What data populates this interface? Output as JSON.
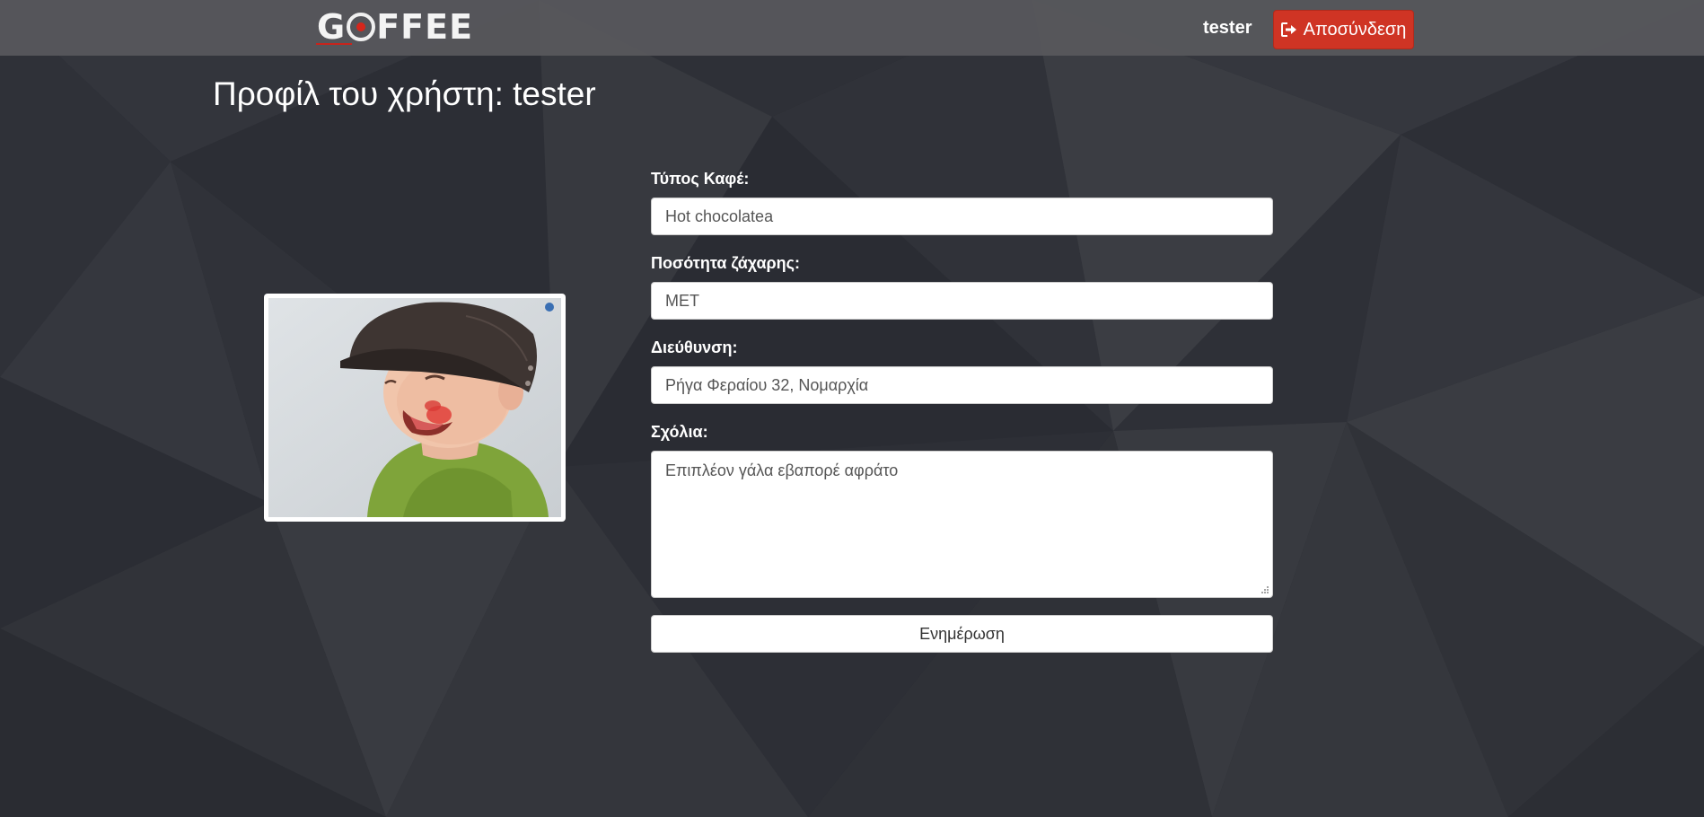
{
  "brand": {
    "logo_pre": "G",
    "logo_post": "FFEE",
    "logo_mark": "coffee-bean-o-icon",
    "accent_color": "#cf3424"
  },
  "navbar": {
    "username": "tester",
    "logout_label": "Αποσύνδεση",
    "logout_icon": "sign-out-icon"
  },
  "page": {
    "title": "Προφίλ του χρήστη: tester"
  },
  "profile_image": {
    "description_icon": "baby-with-cap-photo"
  },
  "form": {
    "coffee_type": {
      "label": "Τύπος Καφέ:",
      "value": "Hot chocolatea"
    },
    "sugar": {
      "label": "Ποσότητα ζάχαρης:",
      "value": "ΜΕΤ"
    },
    "address": {
      "label": "Διεύθυνση:",
      "value": "Ρήγα Φεραίου 32, Νομαρχία"
    },
    "comments": {
      "label": "Σχόλια:",
      "value": "Επιπλέον γάλα εβαπορέ αφράτο"
    },
    "submit_label": "Ενημέρωση"
  }
}
